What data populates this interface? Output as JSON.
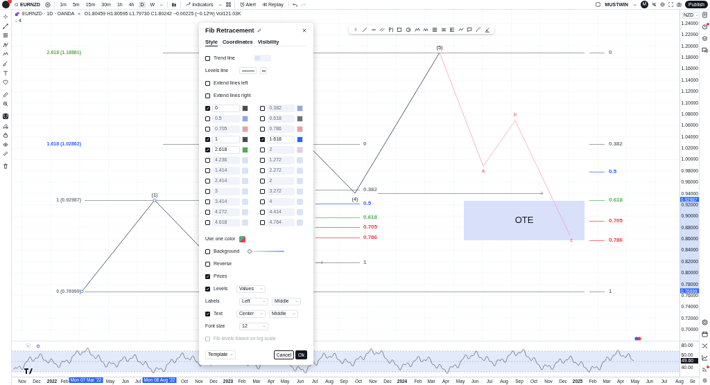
{
  "top_bar": {
    "symbol": "EURNZD",
    "intervals": [
      {
        "label": "1m",
        "selected": false
      },
      {
        "label": "5m",
        "selected": false
      },
      {
        "label": "15m",
        "selected": false
      },
      {
        "label": "30m",
        "selected": false
      },
      {
        "label": "1h",
        "selected": false
      },
      {
        "label": "4h",
        "selected": false
      },
      {
        "label": "D",
        "selected": true
      },
      {
        "label": "W",
        "selected": false
      }
    ],
    "indicators": "Indicators",
    "alert": "Alert",
    "replay": "Replay",
    "account": "MUSTWIN",
    "account_initial": "M",
    "publish": "Publish"
  },
  "legend": {
    "title": "EURNZD · 1D · OANDA",
    "ohlc": "O1.80459 H1.80595 L1.79730 C1.80242 −0.00225 (−0.12%) Vol121.03K",
    "indicator_count": "4"
  },
  "chart": {
    "fib_left_labels": [
      {
        "text": "2.618 (1.18881)",
        "color": "#4caf50"
      },
      {
        "text": "1.618 (1.02862)",
        "color": "#2962ff"
      },
      {
        "text": "1 (0.92987)",
        "color": "#787b86"
      },
      {
        "text": "0 (0.76999)",
        "color": "#787b86"
      }
    ],
    "wave_labels": [
      "(1)",
      "(4)",
      "(5)"
    ],
    "correction_labels": [
      "a",
      "b",
      "c"
    ],
    "fib_mid_labels": [
      {
        "text": "0",
        "color": "#787b86"
      },
      {
        "text": "0.382",
        "color": "#787b86"
      },
      {
        "text": "0.5",
        "color": "#2962ff"
      },
      {
        "text": "0.618",
        "color": "#4caf50"
      },
      {
        "text": "0.705",
        "color": "#f23645"
      },
      {
        "text": "0.786",
        "color": "#f23645"
      },
      {
        "text": "1",
        "color": "#787b86"
      }
    ],
    "fib_right_labels": [
      {
        "text": "0",
        "color": "#787b86"
      },
      {
        "text": "0.382",
        "color": "#787b86"
      },
      {
        "text": "0.5",
        "color": "#2962ff"
      },
      {
        "text": "0.618",
        "color": "#4caf50"
      },
      {
        "text": "0.705",
        "color": "#f23645"
      },
      {
        "text": "0.786",
        "color": "#f23645"
      },
      {
        "text": "1",
        "color": "#787b86"
      }
    ],
    "zone_label": "OTE"
  },
  "price_axis": {
    "currency": "NZD",
    "ticks": [
      "1.24000",
      "1.22000",
      "1.20000",
      "1.18000",
      "1.16000",
      "1.14000",
      "1.12000",
      "1.10000",
      "1.08000",
      "1.06000",
      "1.04000",
      "1.02000",
      "1.00000",
      "0.98000",
      "0.96000",
      "0.94000",
      "0.92000",
      "0.90000",
      "0.88000",
      "0.86000",
      "0.84000",
      "0.82000",
      "0.80000",
      "0.78000",
      "0.76000",
      "0.74000",
      "0.72000",
      "0.70000"
    ],
    "markers": [
      "0.92987",
      "0.76999"
    ]
  },
  "rsi": {
    "ticks": [
      "80.00",
      "60.00",
      "40.00"
    ],
    "current": "49.60"
  },
  "time_axis": {
    "labels": [
      {
        "text": "Nov",
        "kind": "month"
      },
      {
        "text": "Dec",
        "kind": "month"
      },
      {
        "text": "2022",
        "kind": "year"
      },
      {
        "text": "Feb",
        "kind": "month"
      },
      {
        "text": "Mon 07 Mar '22",
        "kind": "marker"
      },
      {
        "text": "May",
        "kind": "month"
      },
      {
        "text": "Jun",
        "kind": "month"
      },
      {
        "text": "Jul",
        "kind": "month"
      },
      {
        "text": "Mon 08 Aug '22",
        "kind": "marker"
      },
      {
        "text": "Oct",
        "kind": "month"
      },
      {
        "text": "Nov",
        "kind": "month"
      },
      {
        "text": "Dec",
        "kind": "month"
      },
      {
        "text": "2023",
        "kind": "year"
      },
      {
        "text": "Feb",
        "kind": "month"
      },
      {
        "text": "Mar",
        "kind": "month"
      },
      {
        "text": "Apr",
        "kind": "month"
      },
      {
        "text": "May",
        "kind": "month"
      },
      {
        "text": "Jun",
        "kind": "month"
      },
      {
        "text": "Jul",
        "kind": "month"
      },
      {
        "text": "Aug",
        "kind": "month"
      },
      {
        "text": "Sep",
        "kind": "month"
      },
      {
        "text": "Oct",
        "kind": "month"
      },
      {
        "text": "Nov",
        "kind": "month"
      },
      {
        "text": "Dec",
        "kind": "month"
      },
      {
        "text": "2024",
        "kind": "year"
      },
      {
        "text": "Feb",
        "kind": "month"
      },
      {
        "text": "Mar",
        "kind": "month"
      },
      {
        "text": "Apr",
        "kind": "month"
      },
      {
        "text": "May",
        "kind": "month"
      },
      {
        "text": "Jun",
        "kind": "month"
      },
      {
        "text": "Jul",
        "kind": "month"
      },
      {
        "text": "Aug",
        "kind": "month"
      },
      {
        "text": "Sep",
        "kind": "month"
      },
      {
        "text": "Oct",
        "kind": "month"
      },
      {
        "text": "Nov",
        "kind": "month"
      },
      {
        "text": "Dec",
        "kind": "month"
      },
      {
        "text": "2025",
        "kind": "year"
      },
      {
        "text": "Feb",
        "kind": "month"
      },
      {
        "text": "Mar",
        "kind": "month"
      },
      {
        "text": "Apr",
        "kind": "month"
      },
      {
        "text": "May",
        "kind": "month"
      },
      {
        "text": "Jun",
        "kind": "month"
      },
      {
        "text": "Jul",
        "kind": "month"
      },
      {
        "text": "Aug",
        "kind": "month"
      },
      {
        "text": "Se",
        "kind": "month"
      }
    ]
  },
  "dialog": {
    "title": "Fib Retracement",
    "tabs": [
      {
        "label": "Style",
        "selected": true
      },
      {
        "label": "Coordinates",
        "selected": false
      },
      {
        "label": "Visibility",
        "selected": false
      }
    ],
    "trend_line": {
      "label": "Trend line",
      "checked": false
    },
    "levels_line": {
      "label": "Levels line"
    },
    "extend_left": {
      "label": "Extend lines left",
      "checked": false
    },
    "extend_right": {
      "label": "Extend lines right",
      "checked": false
    },
    "levels": [
      {
        "value": "0",
        "checked": true,
        "color": "#4a4a4a"
      },
      {
        "value": "0.382",
        "checked": false,
        "color": "#8fa5f0"
      },
      {
        "value": "0.5",
        "checked": false,
        "color": "#8fa5f0"
      },
      {
        "value": "0.618",
        "checked": false,
        "color": "#707070"
      },
      {
        "value": "0.705",
        "checked": false,
        "color": "#e8a0a0"
      },
      {
        "value": "0.786",
        "checked": false,
        "color": "#e8a0a0"
      },
      {
        "value": "1",
        "checked": true,
        "color": "#4a4a4a"
      },
      {
        "value": "1.618",
        "checked": true,
        "color": "#2962ff"
      },
      {
        "value": "2.618",
        "checked": true,
        "color": "#4caf50"
      },
      {
        "value": "2",
        "checked": false,
        "color": "#e8cce8"
      },
      {
        "value": "4.236",
        "checked": false,
        "color": "#d6e4f7"
      },
      {
        "value": "1.272",
        "checked": false,
        "color": "#d6e4f7"
      },
      {
        "value": "1.414",
        "checked": false,
        "color": "#d6e4f7"
      },
      {
        "value": "2.272",
        "checked": false,
        "color": "#d6e4f7"
      },
      {
        "value": "2.414",
        "checked": false,
        "color": "#d6e4f7"
      },
      {
        "value": "2",
        "checked": false,
        "color": "#d6e4f7"
      },
      {
        "value": "3",
        "checked": false,
        "color": "#d6e4f7"
      },
      {
        "value": "3.272",
        "checked": false,
        "color": "#d6e4f7"
      },
      {
        "value": "3.414",
        "checked": false,
        "color": "#d6e4f7"
      },
      {
        "value": "4",
        "checked": false,
        "color": "#d6e4f7"
      },
      {
        "value": "4.272",
        "checked": false,
        "color": "#d6e4f7"
      },
      {
        "value": "4.414",
        "checked": false,
        "color": "#d6e4f7"
      },
      {
        "value": "4.618",
        "checked": false,
        "color": "#d6e4f7"
      },
      {
        "value": "4.764",
        "checked": false,
        "color": "#d6e4f7"
      }
    ],
    "one_color": {
      "label": "Use one color"
    },
    "background": {
      "label": "Background",
      "checked": false,
      "level": 0
    },
    "reverse": {
      "label": "Reverse",
      "checked": false
    },
    "prices": {
      "label": "Prices",
      "checked": true
    },
    "levels_option": {
      "label": "Levels",
      "checked": true,
      "value": "Values"
    },
    "labels_option": {
      "label": "Labels",
      "horizontal": "Left",
      "vertical": "Middle"
    },
    "text_option": {
      "label": "Text",
      "checked": true,
      "horizontal": "Center",
      "vertical": "Middle"
    },
    "font_size": {
      "label": "Font size",
      "value": "12"
    },
    "log_scale": {
      "label": "Fib levels based on log scale",
      "checked": false,
      "disabled": true
    },
    "template": "Template",
    "cancel": "Cancel",
    "ok": "Ok"
  }
}
